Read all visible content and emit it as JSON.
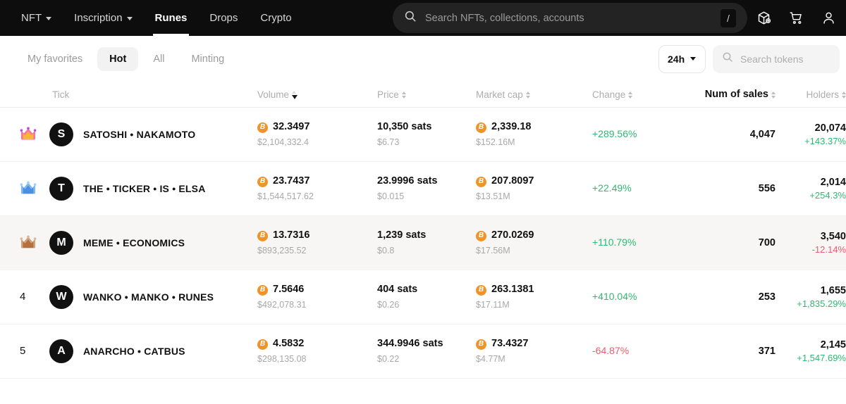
{
  "nav": {
    "items": [
      {
        "label": "NFT",
        "has_caret": true,
        "active": false
      },
      {
        "label": "Inscription",
        "has_caret": true,
        "active": false
      },
      {
        "label": "Runes",
        "has_caret": false,
        "active": true
      },
      {
        "label": "Drops",
        "has_caret": false,
        "active": false
      },
      {
        "label": "Crypto",
        "has_caret": false,
        "active": false
      }
    ],
    "search_placeholder": "Search NFTs, collections, accounts",
    "search_value": "",
    "shortcut_key": "/",
    "icons": [
      "cube-plus-icon",
      "cart-icon",
      "user-icon"
    ]
  },
  "filters": {
    "chips": [
      {
        "label": "My favorites",
        "active": false
      },
      {
        "label": "Hot",
        "active": true
      },
      {
        "label": "All",
        "active": false
      },
      {
        "label": "Minting",
        "active": false
      }
    ],
    "period": "24h",
    "token_search_placeholder": "Search tokens",
    "token_search_value": ""
  },
  "table": {
    "headers": {
      "tick": "Tick",
      "volume": "Volume",
      "price": "Price",
      "market_cap": "Market cap",
      "change": "Change",
      "num_of_sales": "Num of sales",
      "holders": "Holders"
    },
    "sorted_by": "volume",
    "sort_direction": "desc",
    "rows": [
      {
        "rank": "1",
        "rank_badge": "crown-gold",
        "avatar_letter": "S",
        "name": "SATOSHI • NAKAMOTO",
        "volume_btc": "32.3497",
        "volume_usd": "$2,104,332.4",
        "price_sats": "10,350 sats",
        "price_usd": "$6.73",
        "mcap_btc": "2,339.18",
        "mcap_usd": "$152.16M",
        "change": "+289.56%",
        "change_dir": "up",
        "num_of_sales": "4,047",
        "holders": "20,074",
        "holders_change": "+143.37%",
        "holders_change_dir": "up",
        "highlighted": false
      },
      {
        "rank": "2",
        "rank_badge": "crown-silver",
        "avatar_letter": "T",
        "name": "THE • TICKER • IS • ELSA",
        "volume_btc": "23.7437",
        "volume_usd": "$1,544,517.62",
        "price_sats": "23.9996 sats",
        "price_usd": "$0.015",
        "mcap_btc": "207.8097",
        "mcap_usd": "$13.51M",
        "change": "+22.49%",
        "change_dir": "up",
        "num_of_sales": "556",
        "holders": "2,014",
        "holders_change": "+254.3%",
        "holders_change_dir": "up",
        "highlighted": false
      },
      {
        "rank": "3",
        "rank_badge": "crown-bronze",
        "avatar_letter": "M",
        "name": "MEME • ECONOMICS",
        "volume_btc": "13.7316",
        "volume_usd": "$893,235.52",
        "price_sats": "1,239 sats",
        "price_usd": "$0.8",
        "mcap_btc": "270.0269",
        "mcap_usd": "$17.56M",
        "change": "+110.79%",
        "change_dir": "up",
        "num_of_sales": "700",
        "holders": "3,540",
        "holders_change": "-12.14%",
        "holders_change_dir": "down",
        "highlighted": true
      },
      {
        "rank": "4",
        "rank_badge": "",
        "avatar_letter": "W",
        "name": "WANKO • MANKO • RUNES",
        "volume_btc": "7.5646",
        "volume_usd": "$492,078.31",
        "price_sats": "404 sats",
        "price_usd": "$0.26",
        "mcap_btc": "263.1381",
        "mcap_usd": "$17.11M",
        "change": "+410.04%",
        "change_dir": "up",
        "num_of_sales": "253",
        "holders": "1,655",
        "holders_change": "+1,835.29%",
        "holders_change_dir": "up",
        "highlighted": false
      },
      {
        "rank": "5",
        "rank_badge": "",
        "avatar_letter": "A",
        "name": "ANARCHO • CATBUS",
        "volume_btc": "4.5832",
        "volume_usd": "$298,135.08",
        "price_sats": "344.9946 sats",
        "price_usd": "$0.22",
        "mcap_btc": "73.4327",
        "mcap_usd": "$4.77M",
        "change": "-64.87%",
        "change_dir": "down",
        "num_of_sales": "371",
        "holders": "2,145",
        "holders_change": "+1,547.69%",
        "holders_change_dir": "up",
        "highlighted": false
      }
    ]
  },
  "colors": {
    "positive": "#2eb872",
    "negative": "#ef5a6a",
    "btc_orange": "#f0932b",
    "nav_bg": "#0d0d0d"
  }
}
